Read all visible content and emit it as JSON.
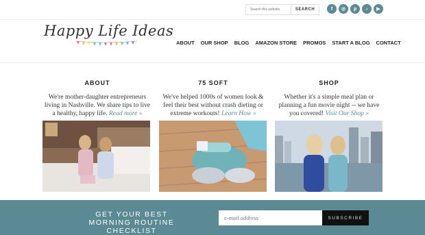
{
  "topbar": {
    "search_placeholder": "Search this website",
    "search_button": "SEARCH",
    "socials": [
      {
        "icon": "facebook-icon",
        "glyph": "f"
      },
      {
        "icon": "instagram-icon",
        "glyph": "◎"
      },
      {
        "icon": "pinterest-icon",
        "glyph": "p"
      },
      {
        "icon": "tiktok-icon",
        "glyph": "♪"
      },
      {
        "icon": "youtube-icon",
        "glyph": "▶"
      }
    ]
  },
  "header": {
    "logo": "Happy Life Ideas",
    "nav": [
      "ABOUT",
      "OUR SHOP",
      "BLOG",
      "AMAZON STORE",
      "PROMOS",
      "START A BLOG",
      "CONTACT"
    ]
  },
  "columns": [
    {
      "title": "ABOUT",
      "text": "We're mother-daughter entrepreneurs living in Nashville. We share tips to live a healthy, happy life.",
      "link": "Read more »"
    },
    {
      "title": "75 SOFT",
      "text": "We've helped 1000s of women look & feel their best without crash dieting or extreme workouts!",
      "link": "Learn How »"
    },
    {
      "title": "SHOP",
      "text": "Whether it's a simple meal plan or planning a fun movie night -- we have you covered!",
      "link": "Visit Our Shop »"
    }
  ],
  "footer": {
    "cta": "GET YOUR BEST MORNING ROUTINE CHECKLIST",
    "email_placeholder": "e-mail address",
    "subscribe": "SUBSCRIBE"
  },
  "colors": {
    "accent": "#5b8a95",
    "dark": "#111111"
  }
}
